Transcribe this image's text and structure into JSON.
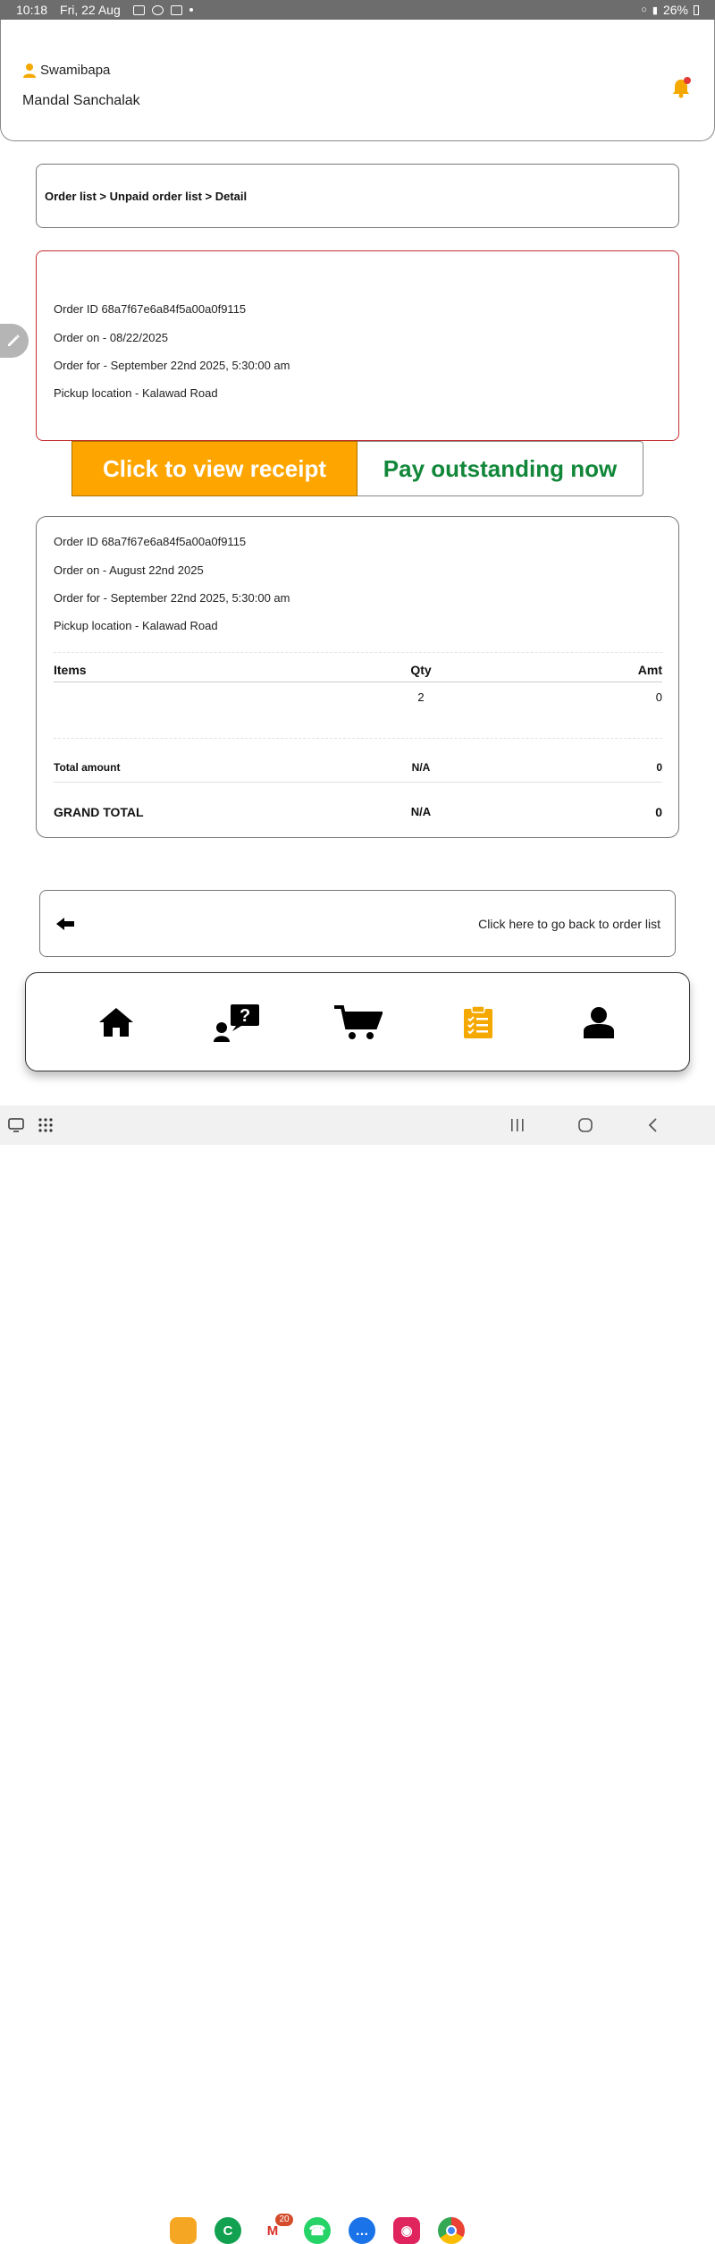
{
  "status_bar": {
    "time": "10:18",
    "date": "Fri, 22 Aug",
    "battery": "26%"
  },
  "header": {
    "user_name": "Swamibapa",
    "role": "Mandal Sanchalak"
  },
  "breadcrumb": "Order list > Unpaid order list > Detail",
  "order_summary": {
    "order_id": "Order ID 68a7f67e6a84f5a00a0f9115",
    "order_on": "Order on - 08/22/2025",
    "order_for": "Order for - September 22nd 2025, 5:30:00 am",
    "pickup": "Pickup location - Kalawad Road"
  },
  "buttons": {
    "view_receipt": "Click to view receipt",
    "pay_outstanding": "Pay outstanding now"
  },
  "order_detail": {
    "order_id": "Order ID 68a7f67e6a84f5a00a0f9115",
    "order_on": "Order on - August 22nd 2025",
    "order_for": "Order for - September 22nd 2025, 5:30:00 am",
    "pickup": "Pickup location - Kalawad Road",
    "columns": {
      "items": "Items",
      "qty": "Qty",
      "amt": "Amt"
    },
    "rows": [
      {
        "item": "",
        "qty": "2",
        "amt": "0"
      }
    ],
    "total": {
      "label": "Total amount",
      "qty": "N/A",
      "amt": "0"
    },
    "grand_total": {
      "label": "GRAND TOTAL",
      "qty": "N/A",
      "amt": "0"
    }
  },
  "back_link": "Click here to go back to order list",
  "bottom_nav": [
    {
      "icon": "home-icon",
      "active": false
    },
    {
      "icon": "question-icon",
      "active": false
    },
    {
      "icon": "cart-icon",
      "active": false
    },
    {
      "icon": "clipboard-icon",
      "active": true
    },
    {
      "icon": "user-icon",
      "active": false
    }
  ],
  "system_bar": {
    "gmail_badge": "20"
  },
  "colors": {
    "accent": "#ffa500",
    "pay_green": "#12873a",
    "order_border": "#c53030",
    "bell": "#f5a800",
    "bell_dot": "#e53935"
  }
}
